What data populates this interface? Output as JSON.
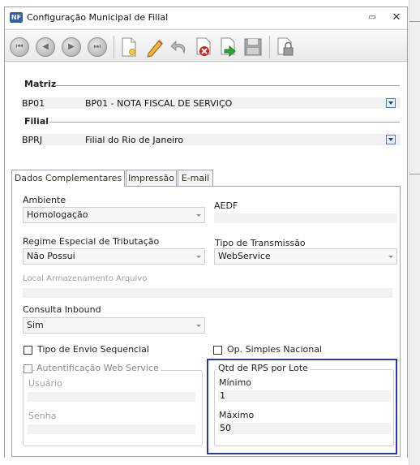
{
  "window": {
    "title": "Configuração Municipal de Filial",
    "app_icon_label": "NF",
    "minimize_glyph": "▭",
    "close_glyph": "✕"
  },
  "toolbar": {
    "nav_glyphs": [
      "⏮",
      "◀",
      "▶",
      "⏭"
    ]
  },
  "matriz": {
    "label": "Matriz",
    "code": "BP01",
    "description": "BP01 - NOTA FISCAL DE SERVIÇO"
  },
  "filial": {
    "label": "Filial",
    "code": "BPRJ",
    "description": "Filial do Rio de Janeiro"
  },
  "tabs": [
    {
      "label": "Dados Complementares",
      "active": true
    },
    {
      "label": "Impressão",
      "active": false
    },
    {
      "label": "E-mail",
      "active": false
    }
  ],
  "form": {
    "ambiente": {
      "label": "Ambiente",
      "value": "Homologação"
    },
    "aedf": {
      "label": "AEDF",
      "value": ""
    },
    "regime": {
      "label": "Regime Especial de Tributação",
      "value": "Não Possui"
    },
    "tipo_transmissao": {
      "label": "Tipo de Transmissão",
      "value": "WebService"
    },
    "local_armazenamento": {
      "label": "Local Armazenamento Arquivo",
      "value": ""
    },
    "consulta_inbound": {
      "label": "Consulta Inbound",
      "value": "Sim"
    },
    "tipo_envio_sequencial": {
      "label": "Tipo de Envio Sequencial",
      "checked": false
    },
    "op_simples_nacional": {
      "label": "Op. Simples Nacional",
      "checked": false
    },
    "autentificacao": {
      "label": "Autentificação Web Service",
      "checked": false,
      "usuario_label": "Usuário",
      "senha_label": "Senha"
    },
    "qtd_rps": {
      "title": "Qtd de RPS por Lote",
      "minimo_label": "Mínimo",
      "minimo_value": "1",
      "maximo_label": "Máximo",
      "maximo_value": "50"
    }
  },
  "colors": {
    "highlight_border": "#2b38a8",
    "lookup_button": "#5a7aa8"
  }
}
